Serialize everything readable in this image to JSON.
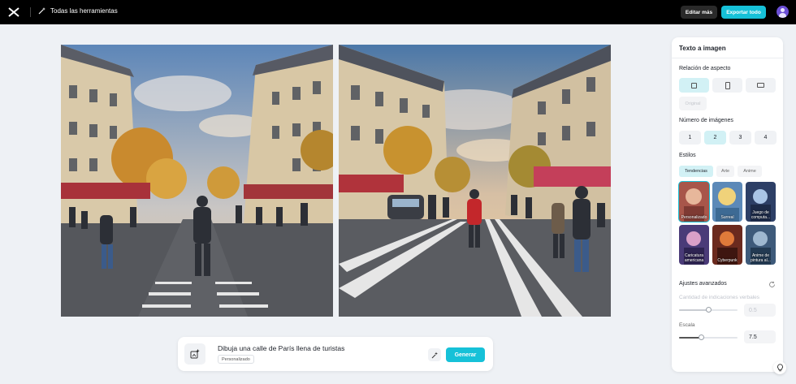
{
  "topbar": {
    "tools_label": "Todas las herramientas",
    "edit_more_label": "Editar más",
    "export_all_label": "Exportar todo"
  },
  "prompt": {
    "text": "Dibuja una calle de París llena de turistas",
    "tag": "Personalizado",
    "generate_label": "Generar"
  },
  "panel": {
    "title": "Texto a imagen",
    "aspect_label": "Relación de aspecto",
    "aspect_options": [
      "square",
      "portrait",
      "landscape"
    ],
    "aspect_selected": "square",
    "original_label": "Original",
    "count_label": "Número de imágenes",
    "count_options": [
      "1",
      "2",
      "3",
      "4"
    ],
    "count_selected": "2",
    "styles_label": "Estilos",
    "style_tabs": [
      "Tendencias",
      "Arte",
      "Anime"
    ],
    "style_tab_selected": "Tendencias",
    "styles": [
      {
        "label": "Personalizado",
        "selected": true
      },
      {
        "label": "Surreal",
        "selected": false
      },
      {
        "label": "Juego de computa...",
        "selected": false
      },
      {
        "label": "Caricatura americana",
        "selected": false
      },
      {
        "label": "Cyberpunk",
        "selected": false
      },
      {
        "label": "Anime de pintura al...",
        "selected": false
      }
    ],
    "advanced_label": "Ajustes avanzados",
    "verbal_label": "Cantidad de indicaciones verbales",
    "verbal_value": "0.5",
    "scale_label": "Escala",
    "scale_value": "7.5",
    "verbal_level": 0.5,
    "scale_level": 0.375
  },
  "icons": [
    "capcut-logo-icon",
    "magic-wand-icon",
    "avatar",
    "image-upload-icon",
    "sparkle-icon",
    "reset-icon",
    "lightbulb-icon"
  ],
  "colors": {
    "accent": "#16c1d8",
    "accent_light": "#d2f1f5",
    "topbar": "#000000",
    "background": "#eef1f5"
  }
}
